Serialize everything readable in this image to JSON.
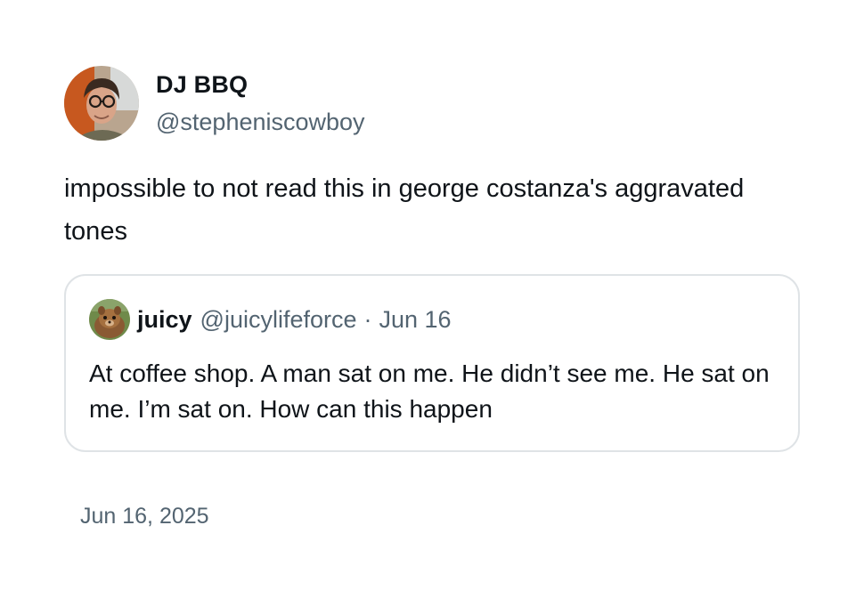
{
  "tweet": {
    "author": {
      "display_name": "DJ BBQ",
      "handle": "@stepheniscowboy",
      "avatar_icon": "user-avatar-photo"
    },
    "text": "impossible to not read this in george costanza's aggravated tones",
    "quote": {
      "display_name": "juicy",
      "handle": "@juicylifeforce",
      "separator": "·",
      "date": "Jun 16",
      "avatar_icon": "user-avatar-photo",
      "text": "At coffee shop. A man sat on me. He didn’t see me. He sat on me. I’m sat on. How can this happen"
    },
    "timestamp": "Jun 16, 2025"
  },
  "colors": {
    "text_primary": "#0f1419",
    "text_secondary": "#536471",
    "border": "#dfe3e6"
  }
}
